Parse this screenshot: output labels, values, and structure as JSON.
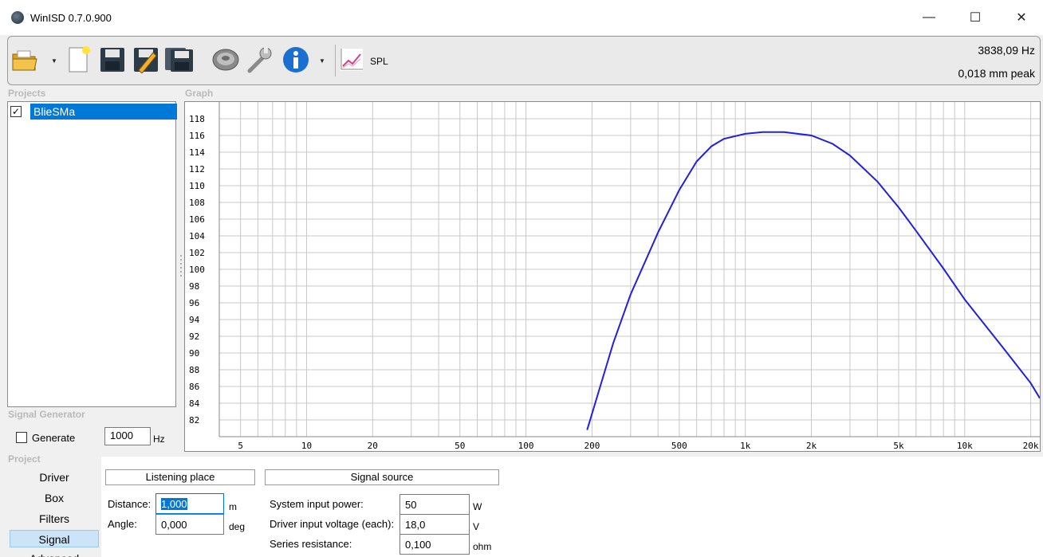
{
  "window": {
    "title": "WinISD 0.7.0.900",
    "minimize": "—",
    "maximize": "☐",
    "close": "✕"
  },
  "toolbar": {
    "icons": [
      "open-folder-icon",
      "new-document-icon",
      "save-icon",
      "save-as-icon",
      "save-all-icon",
      "speaker-driver-icon",
      "wrench-icon",
      "info-icon",
      "spl-graph-icon"
    ],
    "spl_label": "SPL",
    "frequency_readout": "3838,09 Hz",
    "excursion_readout": "0,018 mm peak"
  },
  "sections": {
    "projects": "Projects",
    "graph": "Graph",
    "signal_generator": "Signal Generator",
    "project": "Project"
  },
  "projects": [
    {
      "name": "BlieSMa",
      "checked": true
    }
  ],
  "signal_generator": {
    "generate_label": "Generate",
    "frequency": "1000",
    "unit": "Hz"
  },
  "nav": [
    "Driver",
    "Box",
    "Filters",
    "Signal",
    "Advanced"
  ],
  "nav_active": "Signal",
  "listening": {
    "header": "Listening place",
    "distance_label": "Distance:",
    "distance_value": "1,000",
    "distance_unit": "m",
    "angle_label": "Angle:",
    "angle_value": "0,000",
    "angle_unit": "deg"
  },
  "source": {
    "header": "Signal source",
    "power_label": "System input power:",
    "power_value": "50",
    "power_unit": "W",
    "voltage_label": "Driver input voltage (each):",
    "voltage_value": "18,0",
    "voltage_unit": "V",
    "resistance_label": "Series resistance:",
    "resistance_value": "0,100",
    "resistance_unit": "ohm"
  },
  "chart_data": {
    "type": "line",
    "x_scale": "log",
    "xlim": [
      4,
      22000
    ],
    "ylim": [
      80,
      120
    ],
    "x_ticks": [
      {
        "v": 5,
        "label": "5"
      },
      {
        "v": 10,
        "label": "10"
      },
      {
        "v": 20,
        "label": "20"
      },
      {
        "v": 50,
        "label": "50"
      },
      {
        "v": 100,
        "label": "100"
      },
      {
        "v": 200,
        "label": "200"
      },
      {
        "v": 500,
        "label": "500"
      },
      {
        "v": 1000,
        "label": "1k"
      },
      {
        "v": 2000,
        "label": "2k"
      },
      {
        "v": 5000,
        "label": "5k"
      },
      {
        "v": 10000,
        "label": "10k"
      },
      {
        "v": 20000,
        "label": "20k"
      }
    ],
    "y_ticks": [
      82,
      84,
      86,
      88,
      90,
      92,
      94,
      96,
      98,
      100,
      102,
      104,
      106,
      108,
      110,
      112,
      114,
      116,
      118
    ],
    "grid": true,
    "series": [
      {
        "color": "#2020e0",
        "x": [
          190,
          250,
          300,
          400,
          500,
          600,
          700,
          800,
          1000,
          1200,
          1500,
          2000,
          2500,
          3000,
          4000,
          5000,
          6000,
          8000,
          10000,
          15000,
          20000,
          22000
        ],
        "y": [
          80.8,
          91.2,
          97.0,
          104.4,
          109.5,
          112.9,
          114.7,
          115.6,
          116.2,
          116.4,
          116.4,
          116.0,
          115.0,
          113.6,
          110.5,
          107.4,
          104.6,
          100.1,
          96.4,
          90.6,
          86.4,
          84.6
        ]
      }
    ]
  }
}
